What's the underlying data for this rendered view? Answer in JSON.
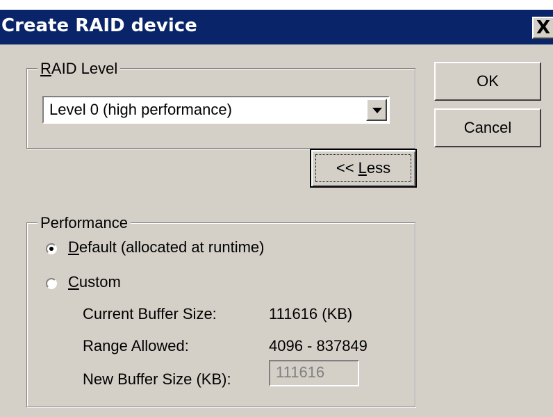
{
  "window": {
    "title": "Create RAID device",
    "close_glyph": "X"
  },
  "raid_level": {
    "legend_accel": "R",
    "legend_rest": "AID Level",
    "selected": "Level 0 (high performance)",
    "dropdown_icon": "chevron-down-icon"
  },
  "buttons": {
    "ok": "OK",
    "cancel": "Cancel",
    "less_prefix": "<< ",
    "less_accel": "L",
    "less_rest": "ess"
  },
  "performance": {
    "legend": "Performance",
    "default_option": {
      "accel": "D",
      "rest": "efault (allocated at runtime)",
      "selected": true
    },
    "custom_option": {
      "accel": "C",
      "rest": "ustom",
      "selected": false
    },
    "current_buffer_label": "Current Buffer Size:",
    "current_buffer_value": "111616 (KB)",
    "range_label": "Range Allowed:",
    "range_value": "4096 - 837849",
    "new_buffer_label": "New Buffer Size (KB):",
    "new_buffer_value": "111616"
  },
  "colors": {
    "titlebar": "#0a246a",
    "face": "#d4d0c8"
  }
}
